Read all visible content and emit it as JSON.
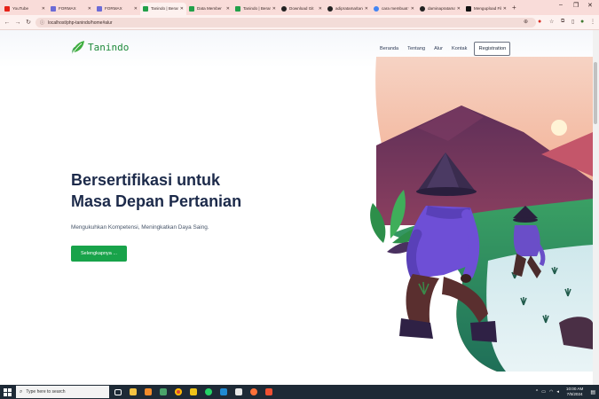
{
  "browser": {
    "tabs": [
      {
        "label": "YouTube",
        "color": "#e62117"
      },
      {
        "label": "FORMAX",
        "color": "#6b6bd6"
      },
      {
        "label": "FORMAX",
        "color": "#6b6bd6"
      },
      {
        "label": "Tanindo | Beranda",
        "color": "#22a04a",
        "active": true
      },
      {
        "label": "Data Member",
        "color": "#22a04a"
      },
      {
        "label": "Tanindo | Beranda",
        "color": "#22a04a"
      },
      {
        "label": "Download Git",
        "color": "#222222"
      },
      {
        "label": "adipratama/tanindo",
        "color": "#222222"
      },
      {
        "label": "cara membuat web",
        "color": "#4285f4"
      },
      {
        "label": "daminapratama/ta",
        "color": "#222222"
      },
      {
        "label": "Mengupload File",
        "color": "#111111"
      }
    ],
    "new_tab": "+",
    "window_controls": {
      "minimize": "–",
      "maximize": "❐",
      "close": "✕"
    },
    "url": "localhost/php-tanindo/home#alur",
    "nav": {
      "back": "←",
      "forward": "→",
      "reload": "↻"
    }
  },
  "site": {
    "logo_text": "Tanindo",
    "nav_links": [
      "Beranda",
      "Tentang",
      "Alur",
      "Kontak"
    ],
    "register_button": "Registration",
    "hero": {
      "title_line1": "Bersertifikasi untuk",
      "title_line2": "Masa Depan Pertanian",
      "subtitle": "Mengukuhkan Kompetensi, Meningkatkan Daya Saing.",
      "cta": "Selengkapnya ..."
    }
  },
  "taskbar": {
    "search_placeholder": "Type here to search",
    "time": "10:00 AM",
    "date": "7/5/2024"
  },
  "colors": {
    "brand_green": "#18a34a",
    "title_navy": "#1c2a4a",
    "tab_strip": "#f9dcd9"
  }
}
